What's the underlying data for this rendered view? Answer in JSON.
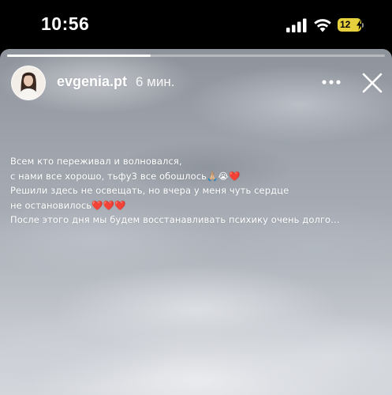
{
  "status_bar": {
    "time": "10:56",
    "battery_level": "12",
    "battery_color": "#e6cf3c",
    "icons": [
      "signal-bars-icon",
      "wifi-icon",
      "battery-charging-icon"
    ]
  },
  "story": {
    "progress_fraction": 0.38,
    "username": "evgenia.pt",
    "posted_ago": "6 мин.",
    "more_icon": "more-horizontal-icon",
    "close_icon": "close-icon",
    "text_lines": [
      "Всем кто переживал и волновался,",
      "с нами все хорошо, тьфу3 все обошлось🙏🏼😭❤️",
      "Решили здесь не освещать, но вчера у меня чуть сердце",
      "не остановилось❤️❤️❤️",
      "После этого дня мы будем восстанавливать психику очень долго…"
    ]
  }
}
